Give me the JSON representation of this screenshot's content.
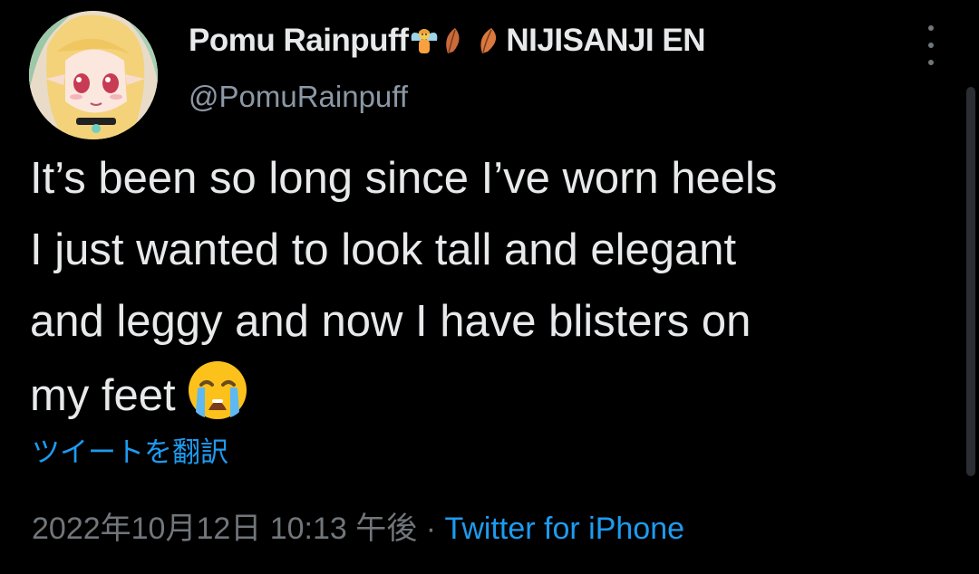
{
  "user": {
    "display_name_text": "Pomu Rainpuff",
    "display_name_suffix": "NIJISANJI EN",
    "name_emojis": [
      "fairy-emoji",
      "fallen-leaf-emoji",
      "fallen-leaf-emoji"
    ],
    "handle": "@PomuRainpuff",
    "avatar": "avatar-image"
  },
  "tweet": {
    "lines": [
      "It’s been so long since I’ve worn heels",
      "I just wanted to look tall and elegant",
      "and leggy and now I have blisters on",
      "my feet"
    ],
    "trailing_emoji": "loudly-crying-face-emoji",
    "translate_label": "ツイートを翻訳",
    "timestamp": "2022年10月12日 10:13 午後",
    "separator": " · ",
    "source": "Twitter for iPhone"
  },
  "icons": {
    "more": "more-options-icon"
  },
  "colors": {
    "background": "#000000",
    "text": "#e7e9ea",
    "secondary": "#71767b",
    "link": "#1d9bf0"
  }
}
